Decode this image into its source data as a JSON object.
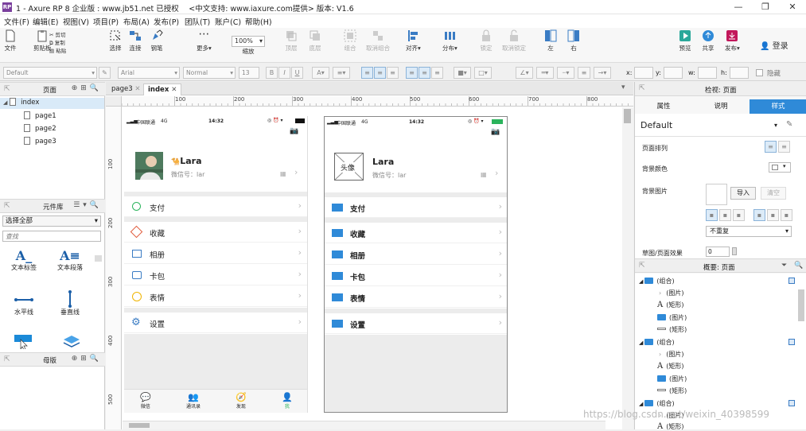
{
  "titlebar": {
    "title": "1 - Axure RP 8 企业版 : www.jb51.net 已授权　 <中文支持: www.iaxure.com提供> 版本: V1.6",
    "icon": "RP"
  },
  "menu": [
    "文件(F)",
    "编辑(E)",
    "视图(V)",
    "项目(P)",
    "布局(A)",
    "发布(P)",
    "团队(T)",
    "账户(C)",
    "帮助(H)"
  ],
  "toolbar": {
    "file": "文件",
    "clipboard": "剪贴板",
    "cut": "剪切",
    "copy": "复制",
    "paste": "粘贴",
    "select": "选择",
    "connect": "连接",
    "pen": "钢笔",
    "more": "更多",
    "zoom_value": "100%",
    "zoom_label": "缩放",
    "top": "顶层",
    "bottom": "底层",
    "group": "组合",
    "ungroup": "取消组合",
    "align": "对齐",
    "distribute": "分布",
    "lock": "锁定",
    "unlock": "取消锁定",
    "left": "左",
    "right": "右",
    "preview": "预览",
    "share": "共享",
    "publish": "发布",
    "login": "登录"
  },
  "format": {
    "style": "Default",
    "font": "Arial",
    "weight": "Normal",
    "size": "13",
    "x_label": "x:",
    "y_label": "y:",
    "w_label": "w:",
    "h_label": "h:",
    "hidden": "隐藏"
  },
  "pages_panel": {
    "title": "页面",
    "items": [
      "index",
      "page1",
      "page2",
      "page3"
    ]
  },
  "library_panel": {
    "title": "元件库",
    "select": "选择全部",
    "search_placeholder": "查找",
    "widgets": [
      "文本标签",
      "文本段落",
      "水平线",
      "垂直线"
    ]
  },
  "masters_panel": {
    "title": "母版"
  },
  "tabs": {
    "page3": "page3",
    "index": "index"
  },
  "ruler": {
    "h": [
      "100",
      "200",
      "300",
      "400",
      "500",
      "600",
      "700",
      "800"
    ],
    "v": [
      "100",
      "200",
      "300",
      "400",
      "500"
    ]
  },
  "phone": {
    "carrier": "中国联通",
    "network": "4G",
    "time": "14:32",
    "name": "Lara",
    "wechat_label": "微信号：",
    "wechat_partial": "lar",
    "avatar_placeholder": "头像",
    "rows": [
      "支付",
      "收藏",
      "相册",
      "卡包",
      "表情",
      "设置"
    ],
    "tabbar": [
      "微信",
      "通讯录",
      "发现",
      "我"
    ]
  },
  "inspector": {
    "title": "检视: 页面",
    "tabs": [
      "属性",
      "说明",
      "样式"
    ],
    "style": "Default",
    "page_align": "页面排列",
    "bg_color": "背景颜色",
    "bg_image": "背景图片",
    "import": "导入",
    "clear": "清空",
    "repeat": "不重复",
    "sketch": "草图/页面效果",
    "sketch_value": "0"
  },
  "outline": {
    "title": "概要: 页面",
    "items": [
      "(组合)",
      "(图片)",
      "(矩形)",
      "(图片)",
      "(矩形)",
      "(组合)",
      "(图片)",
      "(矩形)",
      "(图片)",
      "(矩形)",
      "(组合)",
      "(图片)",
      "(矩形)"
    ]
  },
  "watermark": "https://blog.csdn.net/weixin_40398599"
}
